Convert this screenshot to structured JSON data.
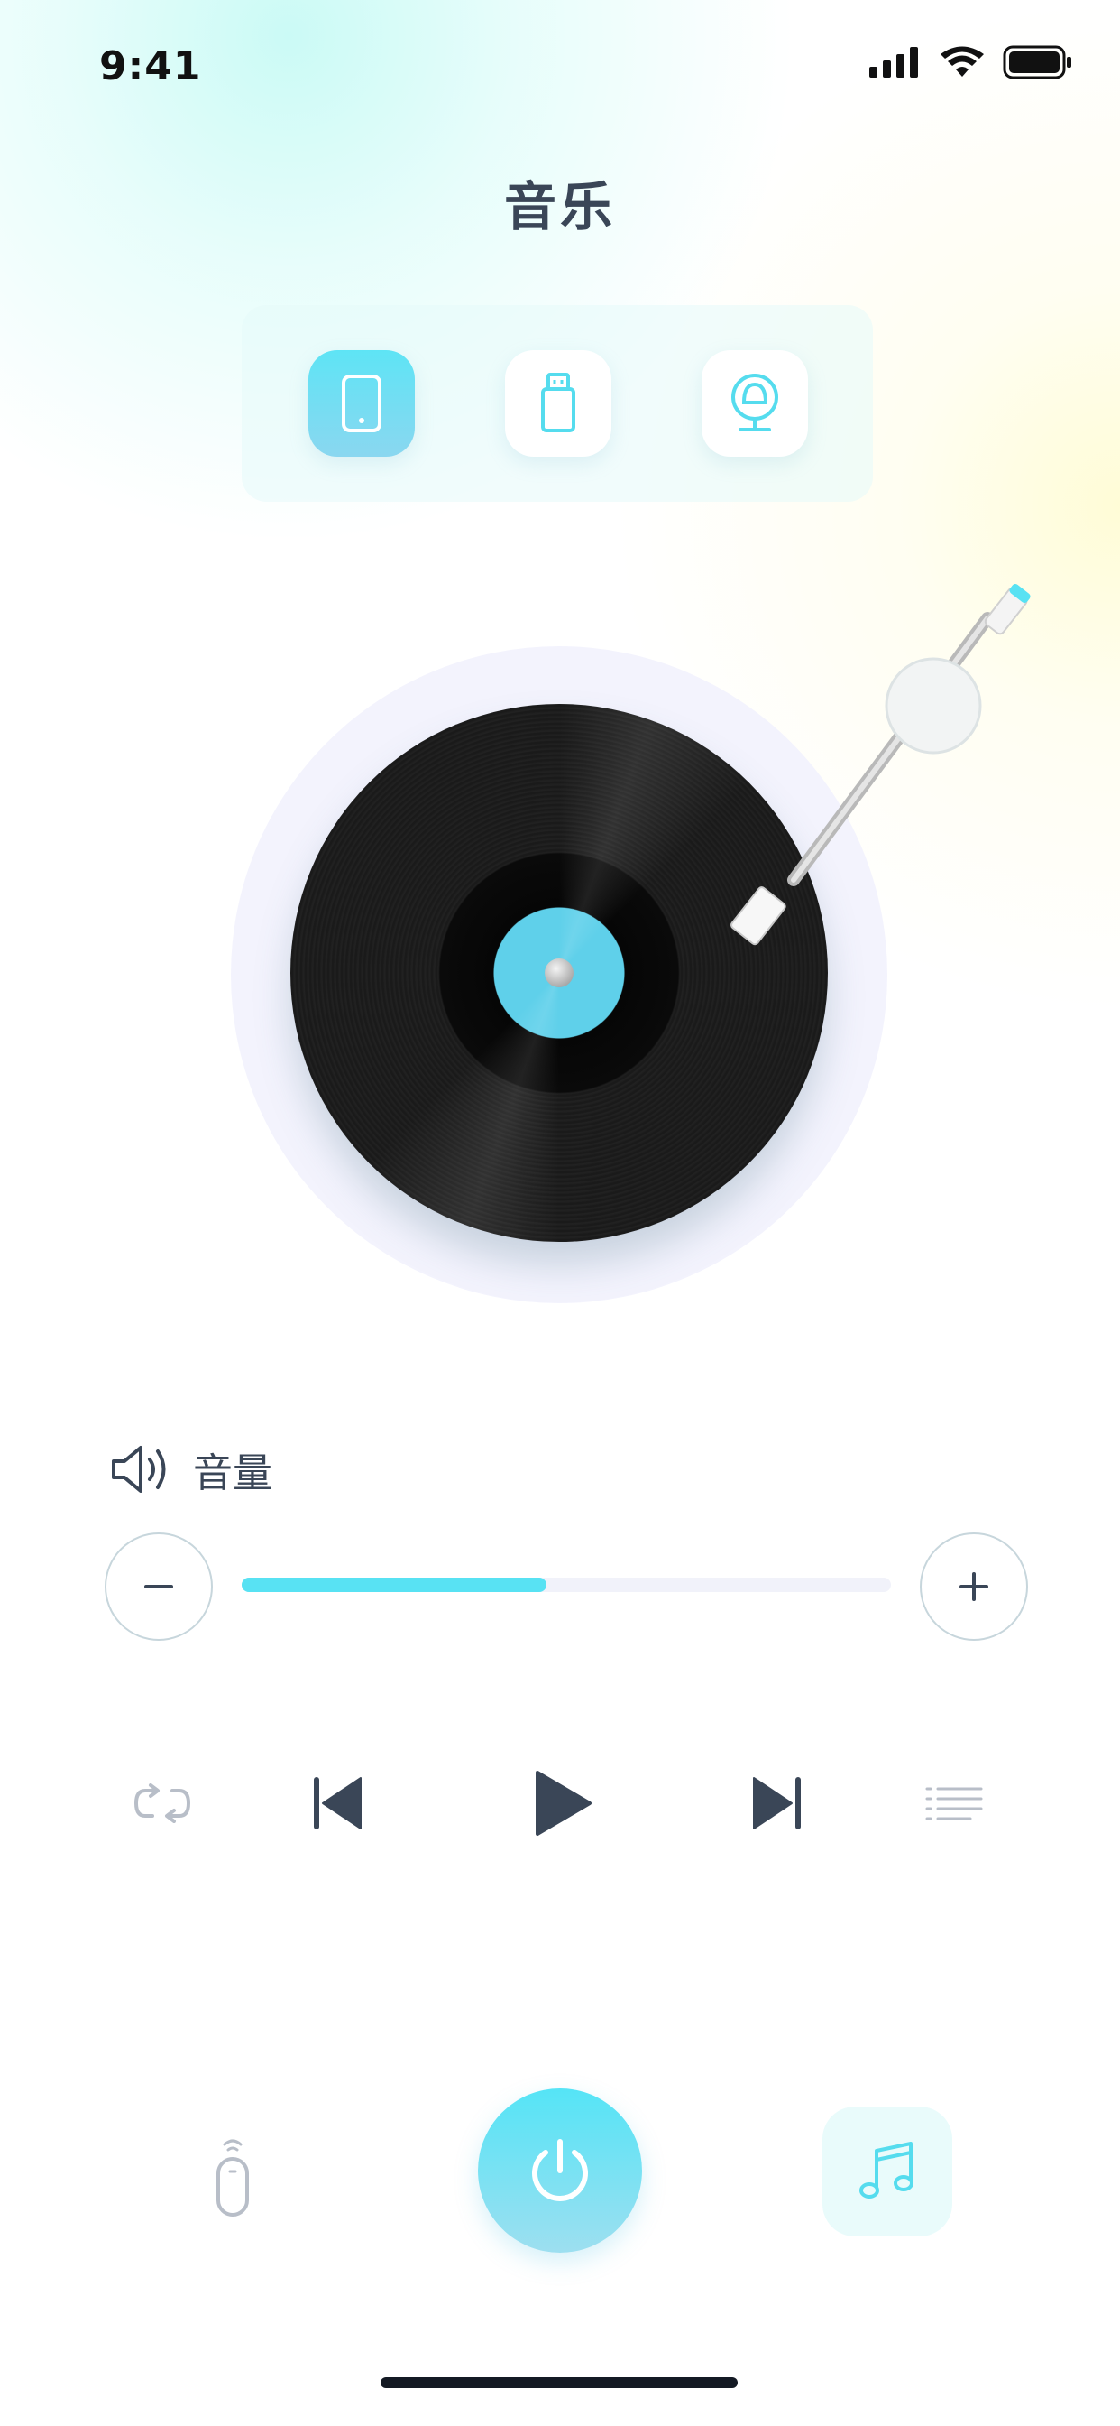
{
  "status_bar": {
    "time": "9:41"
  },
  "header": {
    "title": "音乐"
  },
  "sources": [
    {
      "name": "phone",
      "icon": "phone-icon",
      "active": true
    },
    {
      "name": "usb",
      "icon": "usb-icon",
      "active": false
    },
    {
      "name": "webcam",
      "icon": "webcam-icon",
      "active": false
    }
  ],
  "volume": {
    "label": "音量",
    "level_fraction": 0.47
  },
  "colors": {
    "accent": "#58E2F3",
    "text": "#3A4657",
    "icon_gray": "#B8BEC8"
  }
}
